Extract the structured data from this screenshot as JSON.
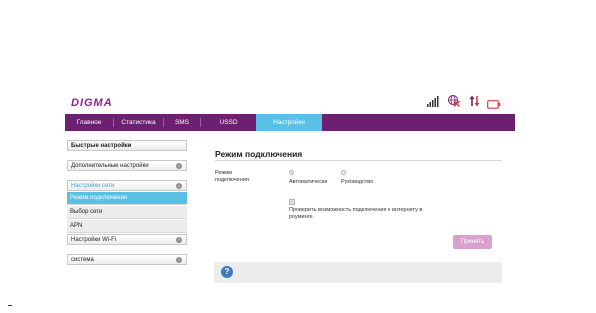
{
  "brand": {
    "logo_text": "DIGMA",
    "accent": "#6d1f71",
    "active_tab_color": "#5ac0e6"
  },
  "status_icons": [
    "signal-strength-icon",
    "globe-no-roaming-icon",
    "data-transfer-arrows-icon",
    "battery-icon"
  ],
  "nav": {
    "tabs": [
      {
        "label": "Главное"
      },
      {
        "label": "Статистика"
      },
      {
        "label": "SMS"
      },
      {
        "label": "USSD"
      },
      {
        "label": "Настройки",
        "active": true
      }
    ]
  },
  "sidebar": {
    "quick_settings": "Быстрые настройки",
    "additional_settings": "Дополнительные настройки",
    "network_settings": "Настройки сети",
    "network_submenu": [
      "Режим подключения",
      "Выбор сети",
      "APN"
    ],
    "wifi_settings": "Настройки Wi-Fi",
    "system": "система"
  },
  "main": {
    "title": "Режим подключения",
    "mode_label_line1": "Режим",
    "mode_label_line2": "подключения",
    "option_auto": "Автоматически",
    "option_manual": "Руководство",
    "roaming_check_line1": "Проверить возможность подключения к интернету в",
    "roaming_check_line2": "роуминге.",
    "apply_button": "Принять"
  },
  "help": {
    "icon_text": "?"
  }
}
